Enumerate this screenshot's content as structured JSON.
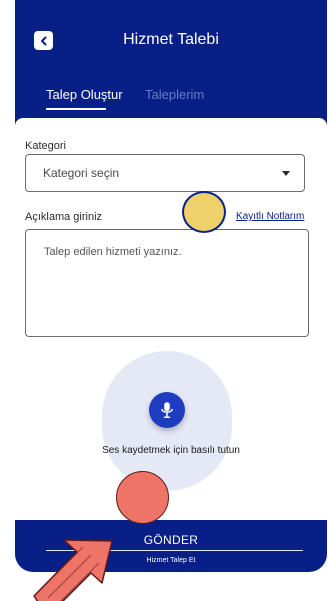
{
  "header": {
    "title": "Hizmet Talebi",
    "back_icon": "chevron-left-icon"
  },
  "tabs": [
    {
      "label": "Talep Oluştur",
      "active": true
    },
    {
      "label": "Taleplerim",
      "active": false
    }
  ],
  "form": {
    "category_label": "Kategori",
    "category_placeholder": "Kategori seçin",
    "description_label": "Açıklama giriniz",
    "saved_notes_link": "Kayıtlı Notlarım",
    "description_placeholder": "Talep edilen hizmeti yazınız."
  },
  "voice": {
    "hint": "Ses kaydetmek için basılı tutun",
    "mic_icon": "microphone-icon"
  },
  "footer": {
    "send_label": "GÖNDER",
    "sub_label": "Hizmet Talep Et"
  },
  "colors": {
    "primary": "#071f86",
    "accent": "#1f3bbf",
    "marker_yellow": "#efd169",
    "marker_red": "#ef7468"
  }
}
